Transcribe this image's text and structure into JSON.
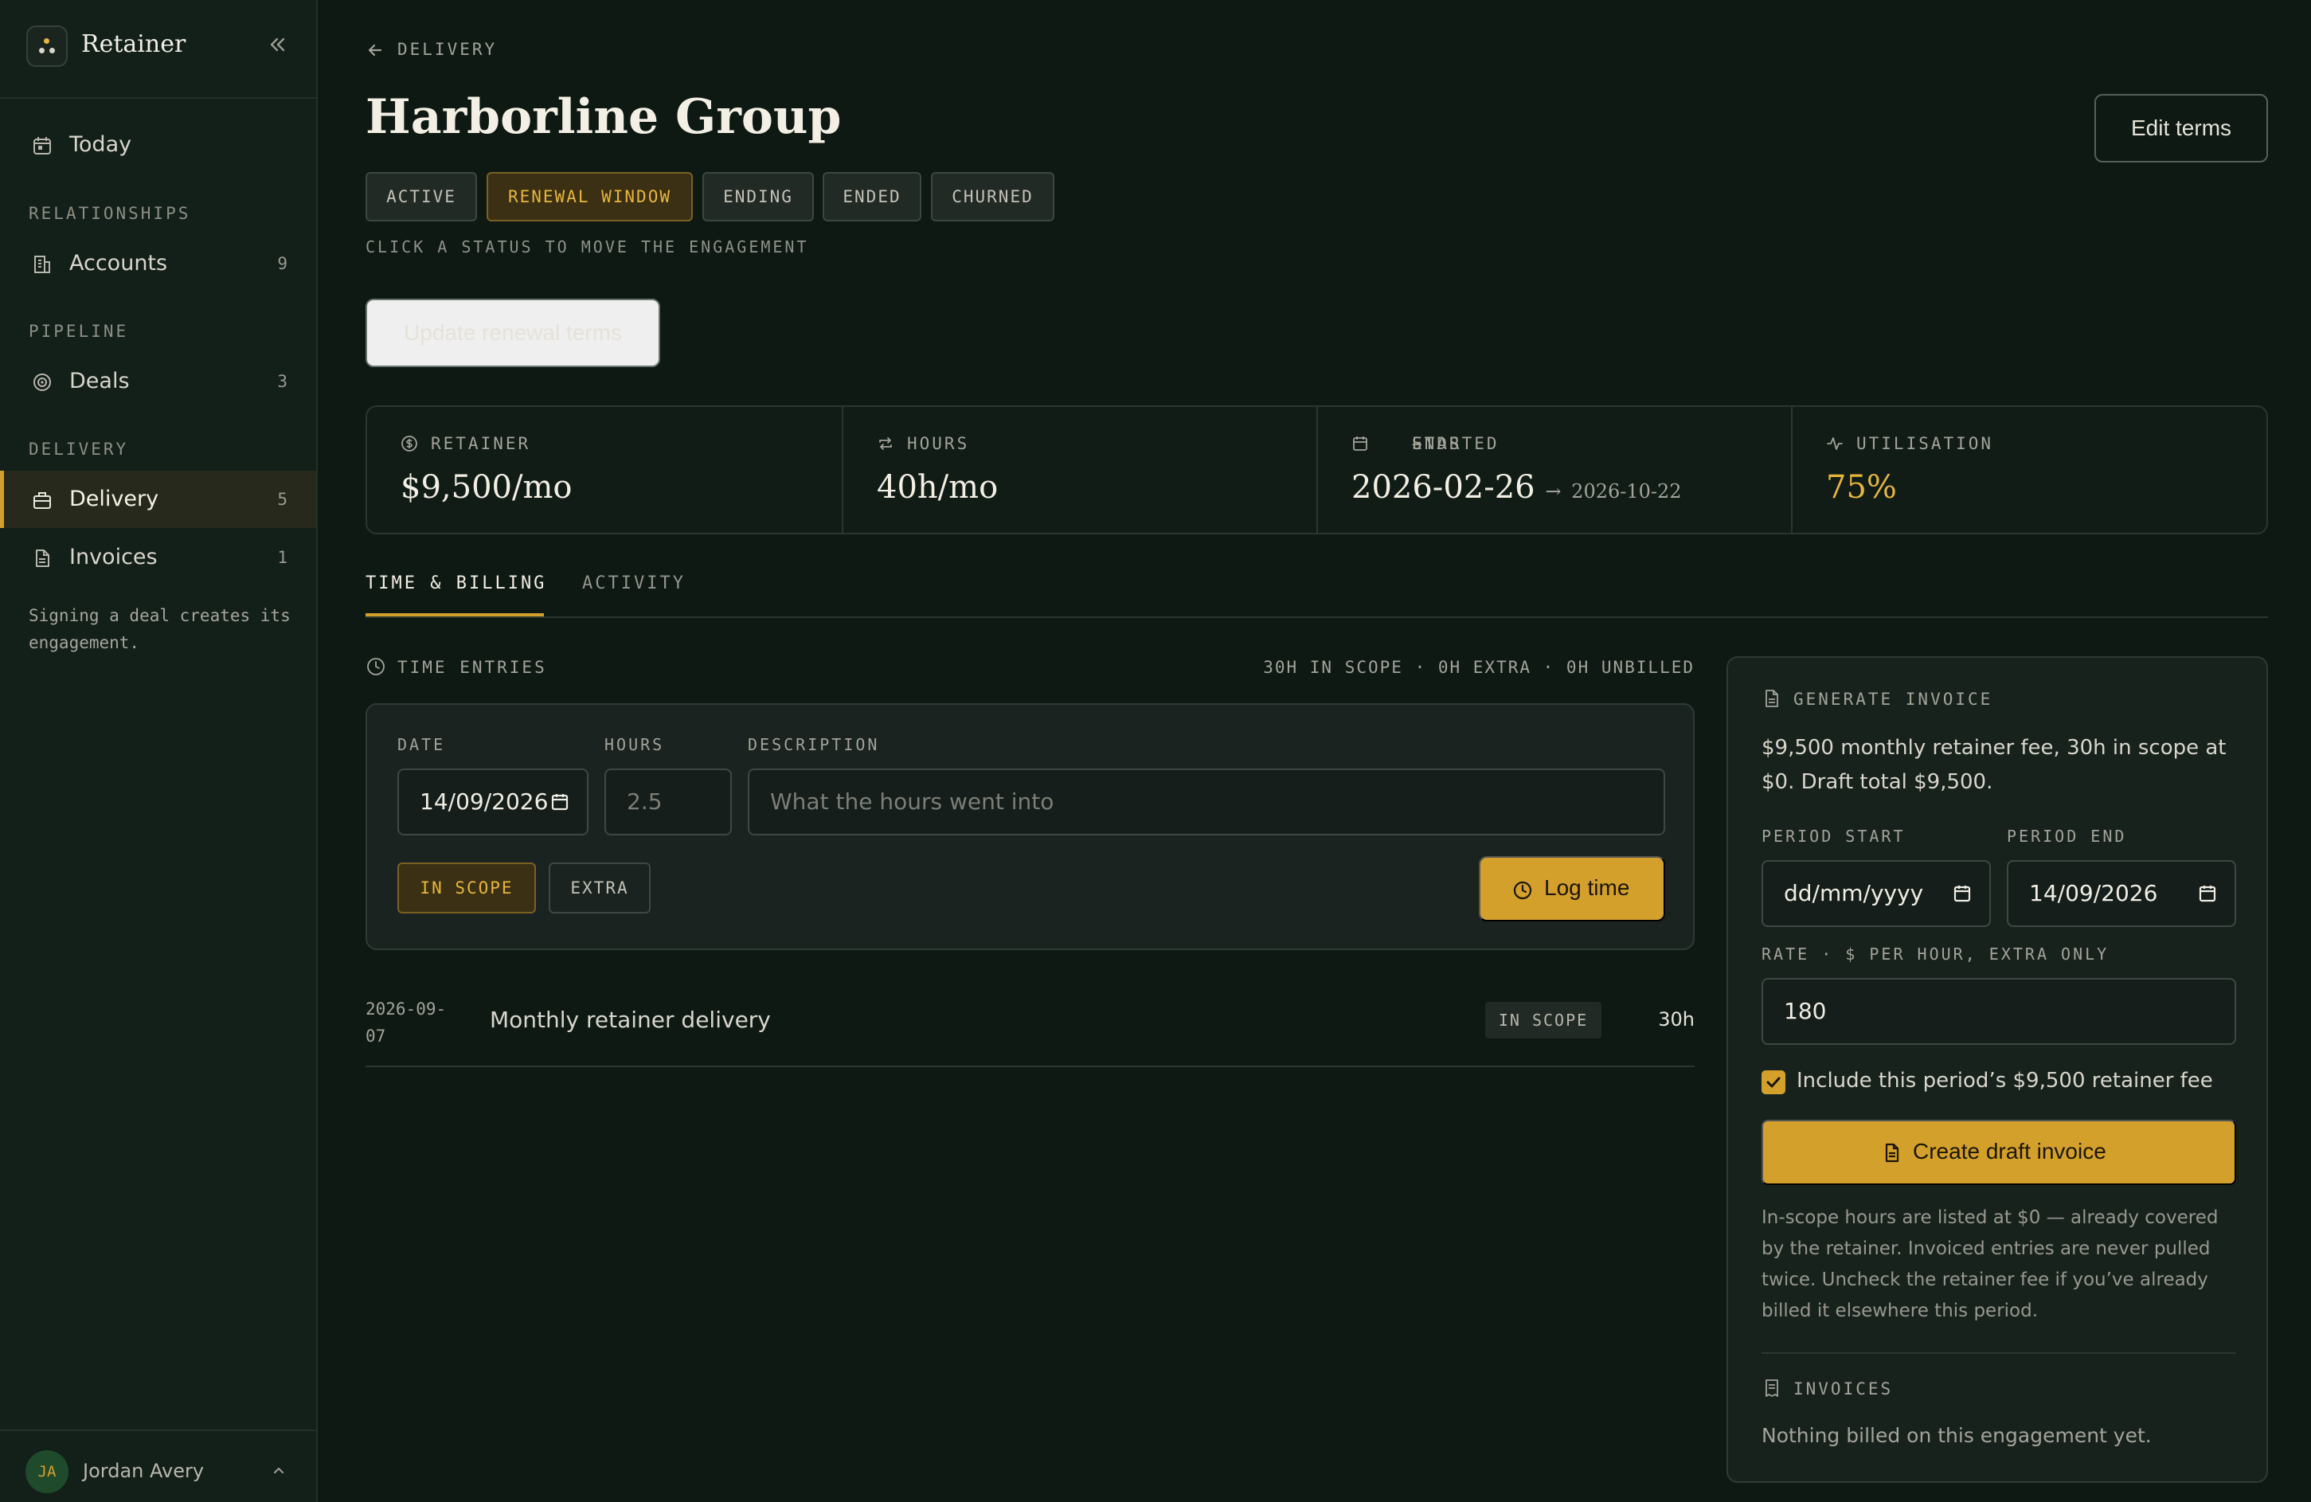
{
  "app": {
    "name": "Retainer",
    "accent_color": "#d4a02c"
  },
  "sidebar": {
    "today_label": "Today",
    "sections": {
      "relationships": "RELATIONSHIPS",
      "pipeline": "PIPELINE",
      "delivery": "DELIVERY"
    },
    "items": {
      "accounts": {
        "label": "Accounts",
        "count": "9"
      },
      "deals": {
        "label": "Deals",
        "count": "3"
      },
      "delivery": {
        "label": "Delivery",
        "count": "5"
      },
      "invoices": {
        "label": "Invoices",
        "count": "1"
      }
    },
    "note": "Signing a deal creates its engagement.",
    "user": {
      "initials": "JA",
      "name": "Jordan Avery"
    }
  },
  "header": {
    "breadcrumb": "DELIVERY",
    "title": "Harborline Group",
    "edit_button": "Edit terms",
    "statuses": [
      "ACTIVE",
      "RENEWAL WINDOW",
      "ENDING",
      "ENDED",
      "CHURNED"
    ],
    "active_status": "RENEWAL WINDOW",
    "status_hint": "CLICK A STATUS TO MOVE THE ENGAGEMENT",
    "renewal_button": "Update renewal terms"
  },
  "stats": {
    "retainer": {
      "label": "RETAINER",
      "value": "$9,500/mo"
    },
    "hours": {
      "label": "HOURS",
      "value": "40h/mo"
    },
    "dates": {
      "label_start": "STARTED",
      "label_end": "ENDS",
      "arrow": "→",
      "start": "2026-02-26",
      "end": "2026-10-22"
    },
    "utilisation": {
      "label": "UTILISATION",
      "value": "75%"
    }
  },
  "tabs": {
    "time_billing": "TIME & BILLING",
    "activity": "ACTIVITY",
    "active": "TIME & BILLING"
  },
  "time_entries": {
    "title": "TIME ENTRIES",
    "summary": "30H IN SCOPE · 0H EXTRA · 0H UNBILLED",
    "form": {
      "date_label": "DATE",
      "date_value": "14/09/2026",
      "hours_label": "HOURS",
      "hours_placeholder": "2.5",
      "description_label": "DESCRIPTION",
      "description_placeholder": "What the hours went into",
      "scope_options": [
        "IN SCOPE",
        "EXTRA"
      ],
      "scope_selected": "IN SCOPE",
      "log_button": "Log time"
    },
    "entries": [
      {
        "date": "2026-09-07",
        "description": "Monthly retainer delivery",
        "scope": "IN SCOPE",
        "hours": "30h"
      }
    ]
  },
  "invoice_panel": {
    "title": "GENERATE INVOICE",
    "summary": "$9,500 monthly retainer fee, 30h in scope at $0. Draft total $9,500.",
    "period_start_label": "PERIOD START",
    "period_start_value": "dd/mm/yyyy",
    "period_end_label": "PERIOD END",
    "period_end_value": "14/09/2026",
    "rate_label": "RATE · $ PER HOUR, EXTRA ONLY",
    "rate_value": "180",
    "include_fee_label": "Include this period’s $9,500 retainer fee",
    "include_fee_checked": true,
    "create_button": "Create draft invoice",
    "note": "In-scope hours are listed at $0 — already covered by the retainer. Invoiced entries are never pulled twice. Uncheck the retainer fee if you’ve already billed it elsewhere this period.",
    "invoices_title": "INVOICES",
    "invoices_empty": "Nothing billed on this engagement yet."
  }
}
